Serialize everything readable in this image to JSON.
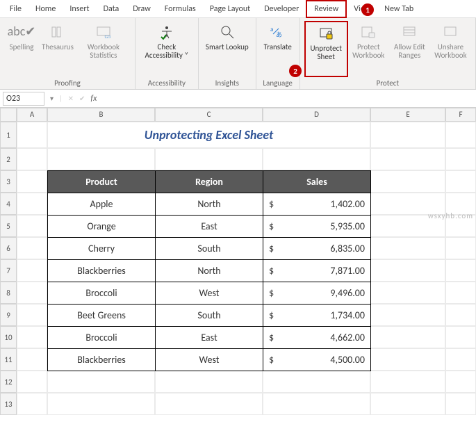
{
  "tabs": [
    "File",
    "Home",
    "Insert",
    "Data",
    "Draw",
    "Formulas",
    "Page Layout",
    "Developer",
    "Review",
    "View",
    "New Tab"
  ],
  "activeTab": "Review",
  "ribbon": {
    "proofing": {
      "label": "Proofing",
      "spelling": "Spelling",
      "thesaurus": "Thesaurus",
      "workbookStats": "Workbook Statistics"
    },
    "accessibility": {
      "label": "Accessibility",
      "check": "Check Accessibility"
    },
    "insights": {
      "label": "Insights",
      "smartLookup": "Smart Lookup"
    },
    "language": {
      "label": "Language",
      "translate": "Translate"
    },
    "protect": {
      "label": "Protect",
      "unprotectSheet": "Unprotect Sheet",
      "protectWorkbook": "Protect Workbook",
      "allowEditRanges": "Allow Edit Ranges",
      "unshareWorkbook": "Unshare Workbook"
    }
  },
  "steps": {
    "one": "1",
    "two": "2"
  },
  "namebox": "O23",
  "fx": "fx",
  "columns": [
    "A",
    "B",
    "C",
    "D",
    "E",
    "F"
  ],
  "rows": [
    "1",
    "2",
    "3",
    "4",
    "5",
    "6",
    "7",
    "8",
    "9",
    "10",
    "11",
    "12",
    "13"
  ],
  "sheetTitle": "Unprotecting Excel Sheet",
  "table": {
    "headers": {
      "product": "Product",
      "region": "Region",
      "sales": "Sales"
    },
    "currency": "$",
    "rows": [
      {
        "product": "Apple",
        "region": "North",
        "sales": "1,402.00"
      },
      {
        "product": "Orange",
        "region": "East",
        "sales": "5,935.00"
      },
      {
        "product": "Cherry",
        "region": "South",
        "sales": "6,835.00"
      },
      {
        "product": "Blackberries",
        "region": "North",
        "sales": "7,871.00"
      },
      {
        "product": "Broccoli",
        "region": "West",
        "sales": "9,496.00"
      },
      {
        "product": "Beet Greens",
        "region": "South",
        "sales": "1,734.00"
      },
      {
        "product": "Broccoli",
        "region": "East",
        "sales": "4,662.00"
      },
      {
        "product": "Blackberries",
        "region": "West",
        "sales": "4,500.00"
      }
    ]
  },
  "watermark": "wsxyhb.com"
}
